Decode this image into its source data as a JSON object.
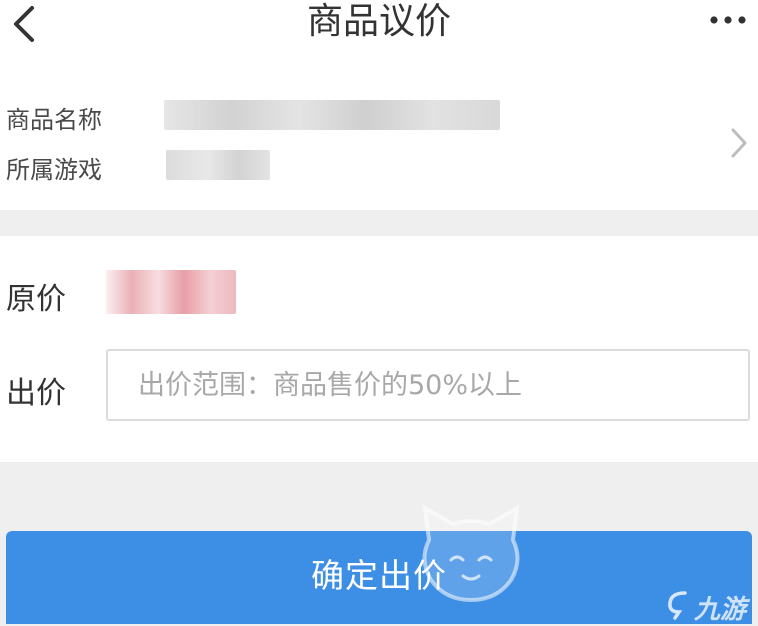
{
  "header": {
    "title": "商品议价",
    "back_icon": "chevron-left-icon",
    "more_icon": "more-horizontal-icon"
  },
  "product": {
    "name_label": "商品名称",
    "game_label": "所属游戏",
    "chevron_icon": "chevron-right-icon"
  },
  "pricing": {
    "original_label": "原价",
    "offer_label": "出价",
    "offer_placeholder": "出价范围：商品售价的50%以上",
    "offer_value": ""
  },
  "submit": {
    "label": "确定出价"
  },
  "watermark": {
    "brand": "九游"
  },
  "colors": {
    "primary": "#3d8ee5",
    "background": "#efefef",
    "text": "#333333",
    "placeholder": "#a8a8a8",
    "price_blur": "#e9a3ab"
  }
}
